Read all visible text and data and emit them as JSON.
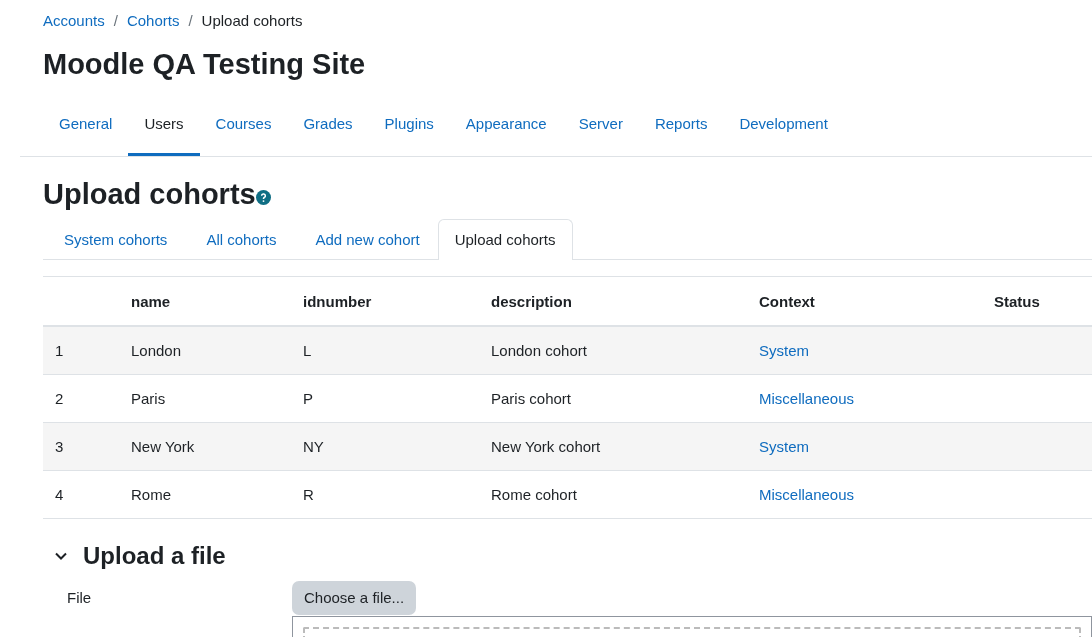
{
  "breadcrumb_separator": "/",
  "breadcrumb": [
    {
      "label": "Accounts",
      "kind": "link"
    },
    {
      "label": "Cohorts",
      "kind": "link"
    },
    {
      "label": "Upload cohorts",
      "kind": "current"
    }
  ],
  "site_title": "Moodle QA Testing Site",
  "nav_tabs": [
    {
      "label": "General",
      "selected": false
    },
    {
      "label": "Users",
      "selected": true
    },
    {
      "label": "Courses",
      "selected": false
    },
    {
      "label": "Grades",
      "selected": false
    },
    {
      "label": "Plugins",
      "selected": false
    },
    {
      "label": "Appearance",
      "selected": false
    },
    {
      "label": "Server",
      "selected": false
    },
    {
      "label": "Reports",
      "selected": false
    },
    {
      "label": "Development",
      "selected": false
    }
  ],
  "page_heading": "Upload cohorts",
  "sub_tabs": [
    {
      "label": "System cohorts",
      "selected": false
    },
    {
      "label": "All cohorts",
      "selected": false
    },
    {
      "label": "Add new cohort",
      "selected": false
    },
    {
      "label": "Upload cohorts",
      "selected": true
    }
  ],
  "table": {
    "columns": [
      "",
      "name",
      "idnumber",
      "description",
      "Context",
      "Status"
    ],
    "rows": [
      {
        "cells": [
          "1",
          "London",
          "L",
          "London cohort",
          "System"
        ]
      },
      {
        "cells": [
          "2",
          "Paris",
          "P",
          "Paris cohort",
          "Miscellaneous"
        ]
      },
      {
        "cells": [
          "3",
          "New York",
          "NY",
          "New York cohort",
          "System"
        ]
      },
      {
        "cells": [
          "4",
          "Rome",
          "R",
          "Rome cohort",
          "Miscellaneous"
        ]
      }
    ]
  },
  "upload_section": {
    "title": "Upload a file",
    "expanded": true,
    "field_label": "File",
    "button": "Choose a file..."
  }
}
